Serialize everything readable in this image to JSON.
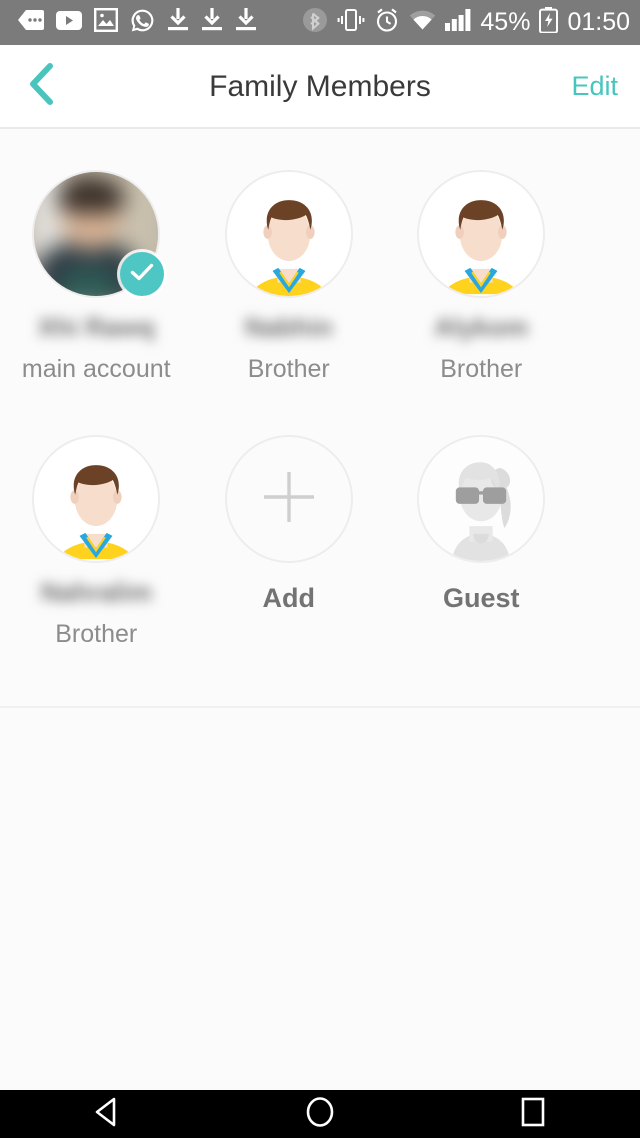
{
  "status_bar": {
    "background": "#7b7b7b",
    "left_icons": [
      {
        "name": "messages-icon",
        "label": "messages"
      },
      {
        "name": "youtube-icon",
        "label": "youtube"
      },
      {
        "name": "photo-icon",
        "label": "photo"
      },
      {
        "name": "whatsapp-icon",
        "label": "whatsapp"
      },
      {
        "name": "download-icon-1",
        "label": "download"
      },
      {
        "name": "download-icon-2",
        "label": "download"
      },
      {
        "name": "download-icon-3",
        "label": "download"
      }
    ],
    "right_icons": [
      {
        "name": "bluetooth-icon",
        "label": "bluetooth"
      },
      {
        "name": "vibrate-icon",
        "label": "vibrate"
      },
      {
        "name": "alarm-icon",
        "label": "alarm"
      },
      {
        "name": "wifi-icon",
        "label": "wifi"
      },
      {
        "name": "signal-icon",
        "label": "signal"
      }
    ],
    "battery_percent": "45%",
    "time": "01:50"
  },
  "header": {
    "title": "Family Members",
    "edit_label": "Edit",
    "back_icon": "chevron-left-icon",
    "accent_color": "#49c5bd",
    "title_color": "#3a3a3a"
  },
  "members": [
    {
      "name": "",
      "name_redacted": "Xhi Rawq",
      "relation": "main account",
      "avatar_type": "photo",
      "selected": true,
      "badge_icon": "check-icon",
      "badge_color": "#4ec6c4"
    },
    {
      "name": "",
      "name_redacted": "Nabhin",
      "relation": "Brother",
      "avatar_type": "male-default",
      "selected": false
    },
    {
      "name": "",
      "name_redacted": "Alykom",
      "relation": "Brother",
      "avatar_type": "male-default",
      "selected": false
    },
    {
      "name": "",
      "name_redacted": "Nahralim",
      "relation": "Brother",
      "avatar_type": "male-default",
      "selected": false
    }
  ],
  "actions": {
    "add_label": "Add",
    "add_icon": "plus-icon",
    "guest_label": "Guest",
    "guest_icon": "guest-avatar-icon"
  },
  "nav_bar": {
    "back": "back-triangle-icon",
    "home": "home-circle-icon",
    "recents": "recents-square-icon"
  },
  "colors": {
    "accent": "#49c5bd",
    "avatar_shirt": "#ffd21e",
    "avatar_collar": "#29a8e0",
    "avatar_hair": "#6b4226",
    "avatar_skin": "#f6ddcc",
    "content_bg": "#fbfbfc"
  }
}
